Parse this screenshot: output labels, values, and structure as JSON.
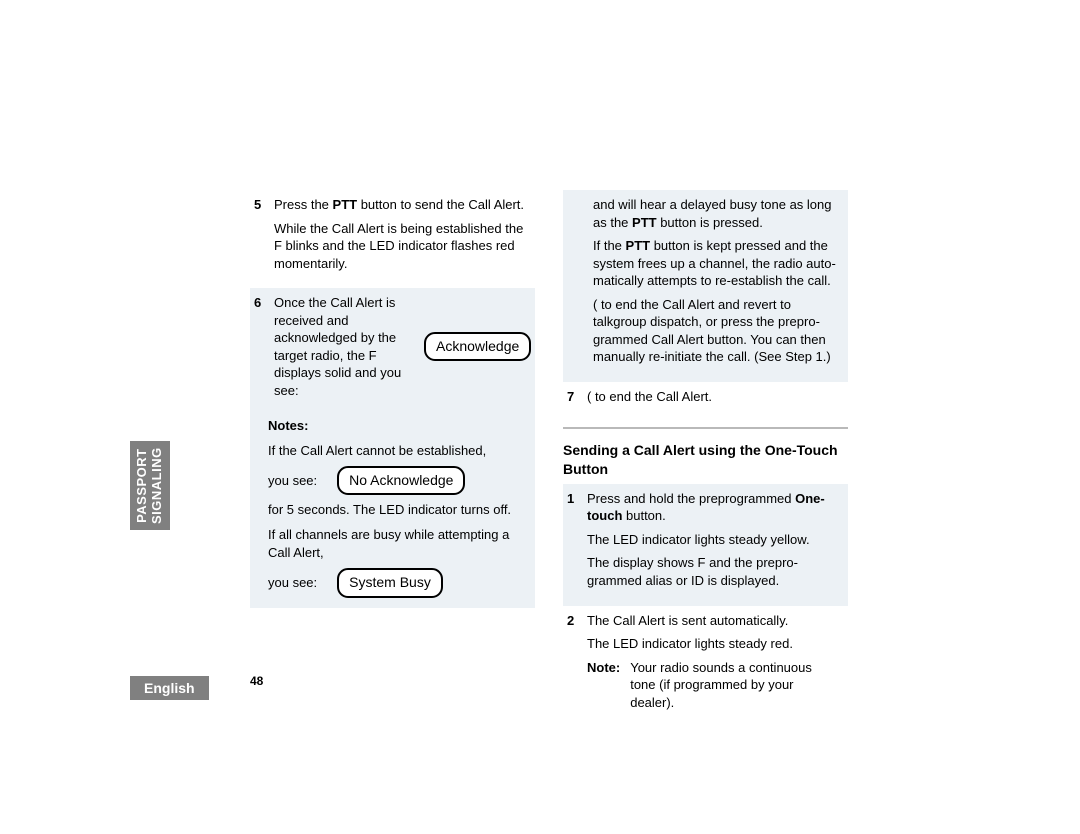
{
  "sidebar": {
    "section_line1": "PASSPORT",
    "section_line2": "SIGNALING",
    "language": "English"
  },
  "page_number": "48",
  "left": {
    "step5": {
      "num": "5",
      "line1_a": "Press the ",
      "line1_b": "PTT",
      "line1_c": " button to send the Call Alert.",
      "para2": "While the Call Alert is being established the F blinks and the LED indicator flashes red momentarily."
    },
    "step6": {
      "num": "6",
      "text": "Once the Call Alert is received and acknowledged by the target radio, the F displays solid and you see:",
      "chip": "Acknowledge"
    },
    "notes": {
      "label": "Notes:",
      "p1": "If the Call Alert cannot be established,",
      "p2_row_txt": "you see:",
      "p2_chip": "No Acknowledge",
      "p3": "for 5 seconds. The LED indicator turns off.",
      "p4": "If all channels are busy while attempting a Call Alert,",
      "p5_row_txt": "you see:",
      "p5_chip": "System Busy"
    }
  },
  "right": {
    "cont": {
      "p1_a": "and will hear a delayed busy tone as long as the ",
      "p1_b": "PTT",
      "p1_c": " button is pressed.",
      "p2_a": "If the ",
      "p2_b": "PTT",
      "p2_c": " button is kept pressed and the system frees up a channel, the radio auto-matically attempts to re-establish the call.",
      "p3": "(        to end the Call Alert and revert to talkgroup dispatch, or press the prepro-grammed Call Alert button. You can then manually re-initiate the call. (See Step 1.)"
    },
    "step7": {
      "num": "7",
      "text": "(        to end the Call Alert."
    },
    "heading": "Sending a Call Alert using the One-Touch Button",
    "ot_step1": {
      "num": "1",
      "line1_a": "Press and hold the preprogrammed ",
      "line1_b": "One-touch",
      "line1_c": " button.",
      "p2": "The LED indicator lights steady yellow.",
      "p3": "The display shows F and the prepro-grammed alias or ID is displayed."
    },
    "ot_step2": {
      "num": "2",
      "p1": "The Call Alert is sent automatically.",
      "p2": "The LED indicator lights steady red.",
      "note_label": "Note:",
      "note_text": "Your radio sounds a continuous tone (if programmed by your dealer)."
    }
  }
}
